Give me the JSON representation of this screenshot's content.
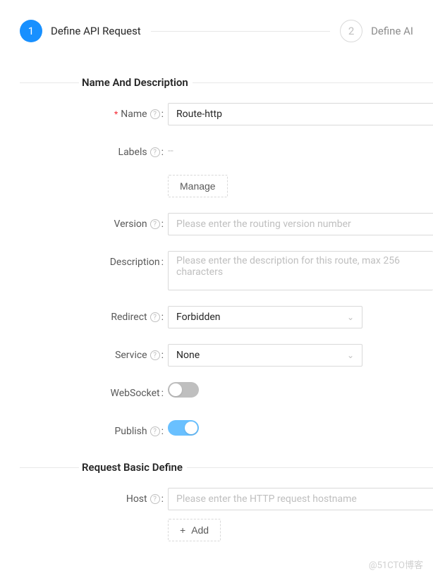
{
  "steps": {
    "step1": {
      "num": "1",
      "title": "Define API Request"
    },
    "step2": {
      "num": "2",
      "title": "Define AI"
    }
  },
  "sections": {
    "nameDesc": "Name And Description",
    "requestBasic": "Request Basic Define"
  },
  "form": {
    "name": {
      "label": "Name",
      "value": "Route-http"
    },
    "labels": {
      "label": "Labels",
      "placeholder": "--",
      "manage": "Manage"
    },
    "version": {
      "label": "Version",
      "placeholder": "Please enter the routing version number"
    },
    "description": {
      "label": "Description",
      "placeholder": "Please enter the description for this route, max 256 characters"
    },
    "redirect": {
      "label": "Redirect",
      "value": "Forbidden"
    },
    "service": {
      "label": "Service",
      "value": "None"
    },
    "websocket": {
      "label": "WebSocket"
    },
    "publish": {
      "label": "Publish"
    },
    "host": {
      "label": "Host",
      "placeholder": "Please enter the HTTP request hostname",
      "add": "Add"
    }
  },
  "watermark": "@51CTO博客"
}
